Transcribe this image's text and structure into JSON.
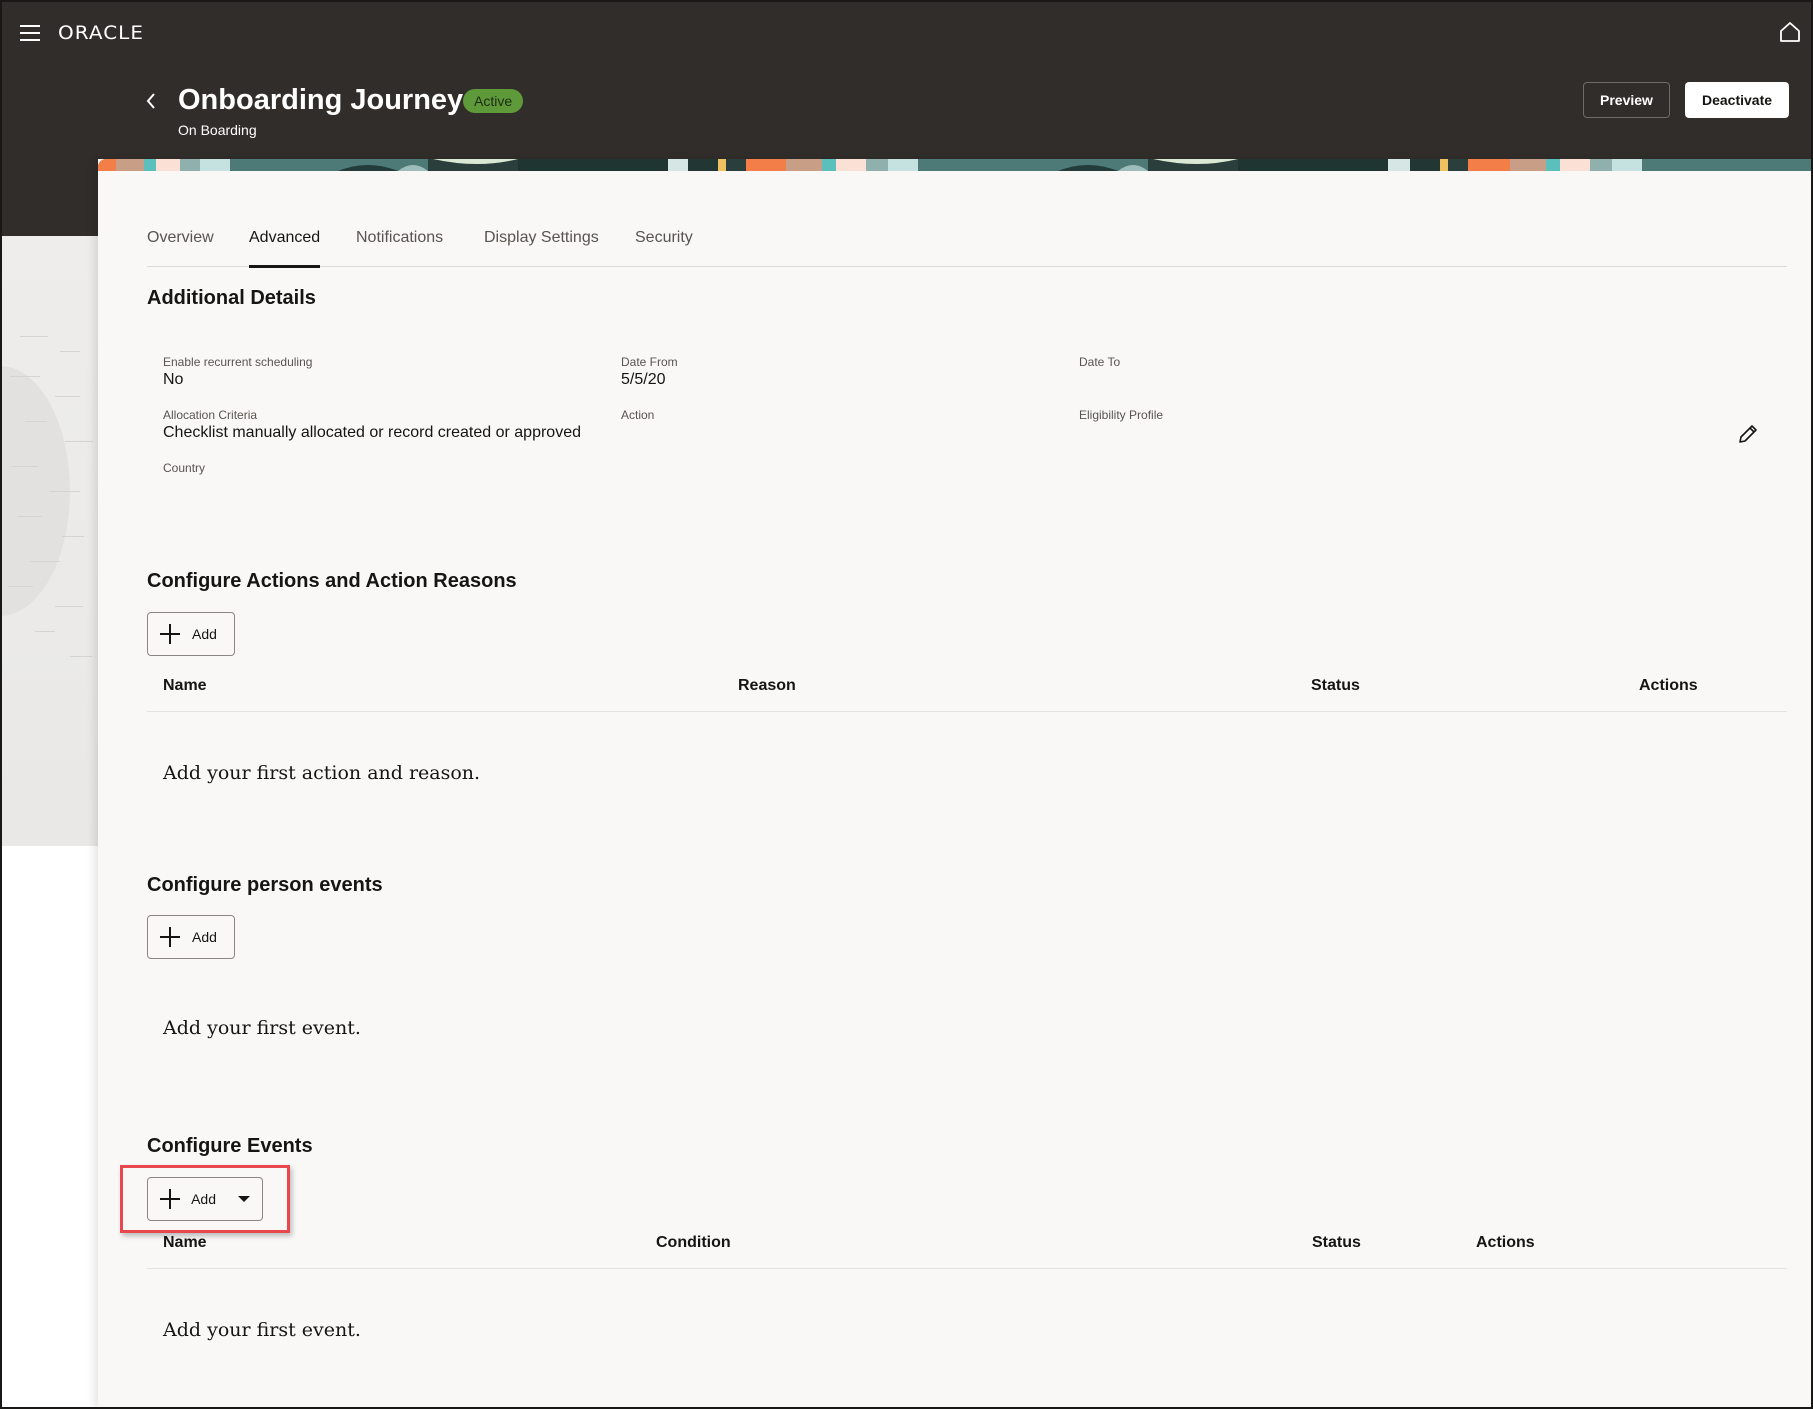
{
  "app": {
    "brand": "ORACLE",
    "menu_icon": "hamburger-menu-icon",
    "home_icon": "home-icon"
  },
  "header": {
    "back_icon": "chevron-left-icon",
    "title": "Onboarding Journey",
    "status_badge": "Active",
    "subtitle": "On Boarding",
    "preview_label": "Preview",
    "deactivate_label": "Deactivate"
  },
  "tabs": [
    {
      "label": "Overview",
      "active": false
    },
    {
      "label": "Advanced",
      "active": true
    },
    {
      "label": "Notifications",
      "active": false
    },
    {
      "label": "Display Settings",
      "active": false
    },
    {
      "label": "Security",
      "active": false
    }
  ],
  "additional_details": {
    "heading": "Additional Details",
    "edit_icon": "pencil-icon",
    "fields": [
      {
        "label": "Enable recurrent scheduling",
        "value": "No"
      },
      {
        "label": "Date From",
        "value": "5/5/20"
      },
      {
        "label": "Date To",
        "value": ""
      },
      {
        "label": "Allocation Criteria",
        "value": "Checklist manually allocated or record created or approved"
      },
      {
        "label": "Action",
        "value": ""
      },
      {
        "label": "Eligibility Profile",
        "value": ""
      },
      {
        "label": "Country",
        "value": ""
      }
    ]
  },
  "actions_section": {
    "heading": "Configure Actions and Action Reasons",
    "add_label": "Add",
    "columns": [
      "Name",
      "Reason",
      "Status",
      "Actions"
    ],
    "empty_text": "Add your first action and reason."
  },
  "person_events_section": {
    "heading": "Configure person events",
    "add_label": "Add",
    "empty_text": "Add your first event."
  },
  "events_section": {
    "heading": "Configure Events",
    "add_label": "Add",
    "columns": [
      "Name",
      "Condition",
      "Status",
      "Actions"
    ],
    "empty_text": "Add your first event."
  },
  "colors": {
    "header_bg": "#312d2a",
    "badge_bg": "#5f9a3a",
    "card_bg": "#f9f8f7",
    "highlight": "#e8484d"
  }
}
